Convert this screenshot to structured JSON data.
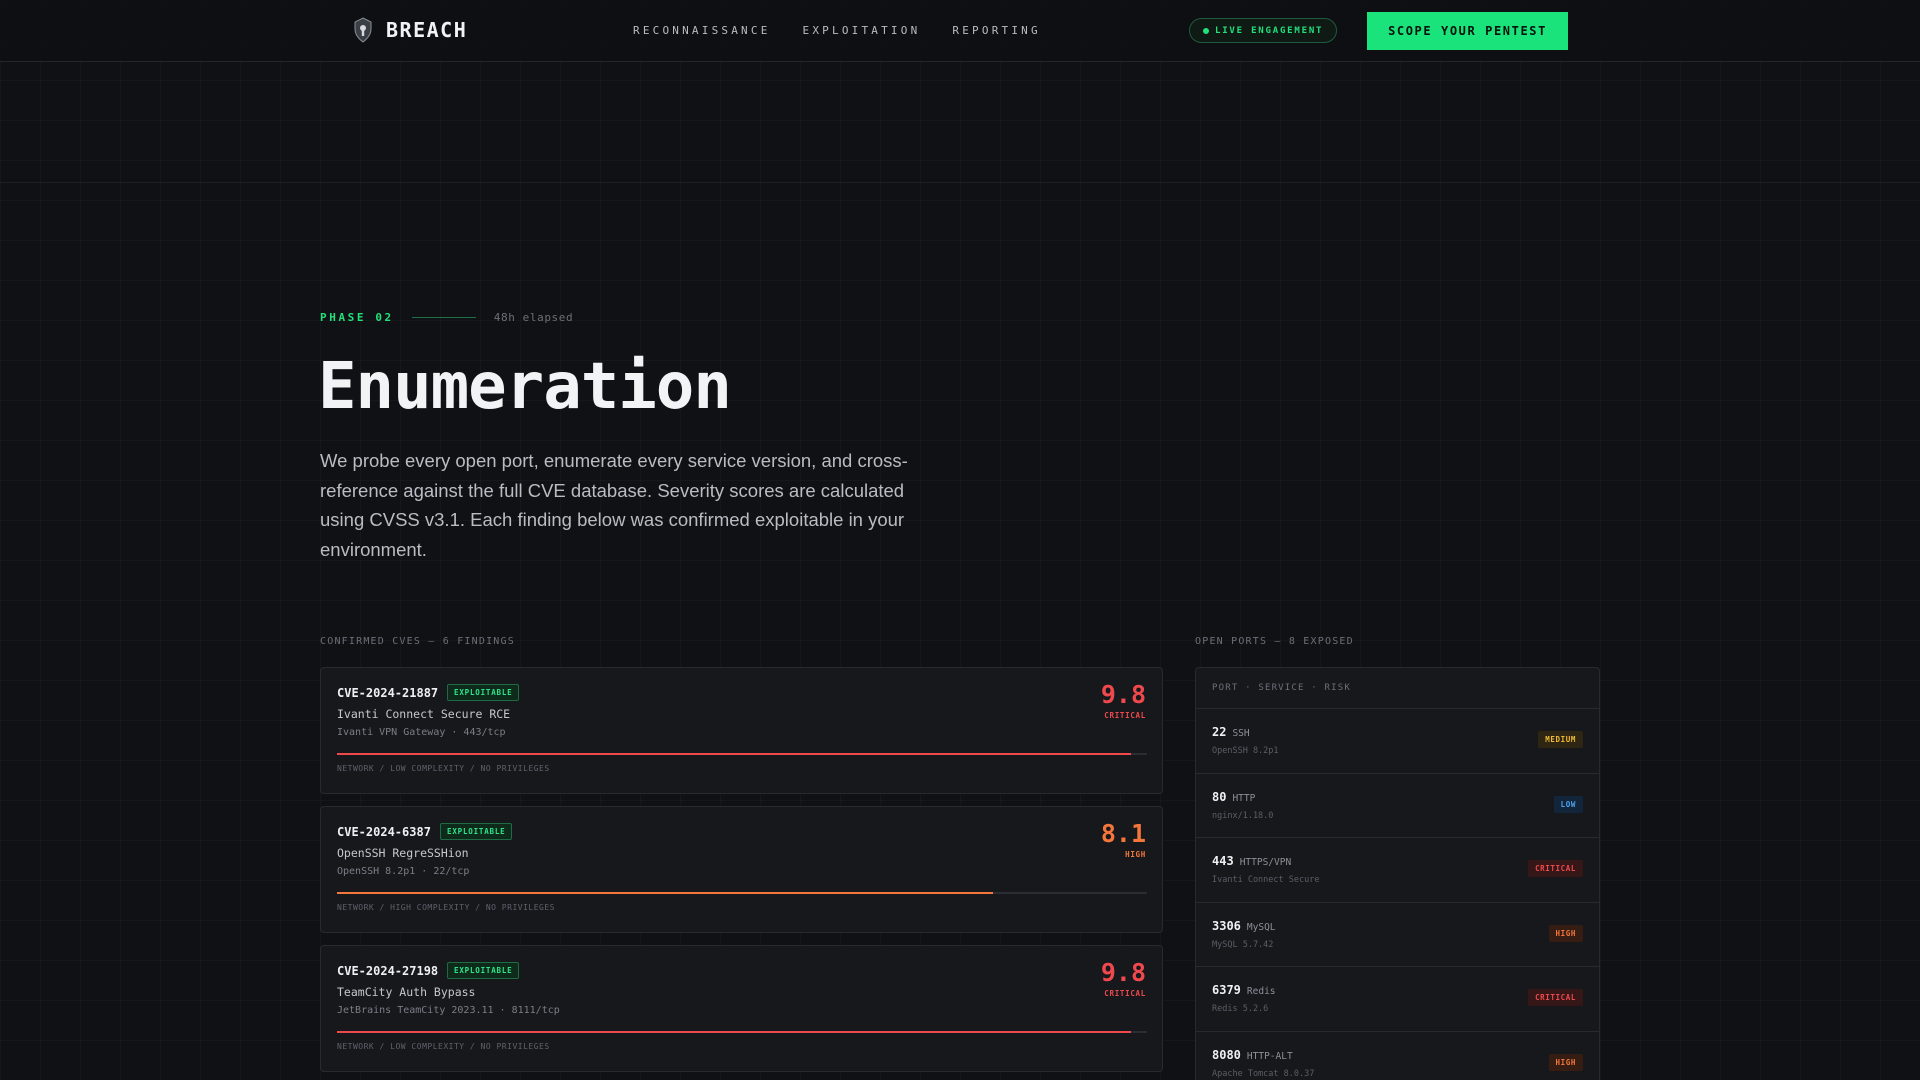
{
  "header": {
    "brand": "BREACH",
    "nav": [
      "RECONNAISSANCE",
      "EXPLOITATION",
      "REPORTING"
    ],
    "live_label": "LIVE ENGAGEMENT",
    "cta_label": "SCOPE YOUR PENTEST"
  },
  "hero": {
    "phase": "PHASE 02",
    "elapsed": "48h elapsed",
    "title": "Enumeration",
    "description": "We probe every open port, enumerate every service version, and cross-reference against the full CVE database. Severity scores are calculated using CVSS v3.1. Each finding below was confirmed exploitable in your environment."
  },
  "cves": {
    "section_label": "CONFIRMED CVES — 6 FINDINGS",
    "items": [
      {
        "id": "CVE-2024-21887",
        "badge": "EXPLOITABLE",
        "name": "Ivanti Connect Secure RCE",
        "target": "Ivanti VPN Gateway · 443/tcp",
        "score": "9.8",
        "severity": "CRITICAL",
        "score_fraction": 0.98,
        "color": "#f0494d",
        "vector": "NETWORK / LOW COMPLEXITY / NO PRIVILEGES"
      },
      {
        "id": "CVE-2024-6387",
        "badge": "EXPLOITABLE",
        "name": "OpenSSH RegreSSHion",
        "target": "OpenSSH 8.2p1 · 22/tcp",
        "score": "8.1",
        "severity": "HIGH",
        "score_fraction": 0.81,
        "color": "#f4763a",
        "vector": "NETWORK / HIGH COMPLEXITY / NO PRIVILEGES"
      },
      {
        "id": "CVE-2024-27198",
        "badge": "EXPLOITABLE",
        "name": "TeamCity Auth Bypass",
        "target": "JetBrains TeamCity 2023.11 · 8111/tcp",
        "score": "9.8",
        "severity": "CRITICAL",
        "score_fraction": 0.98,
        "color": "#f0494d",
        "vector": "NETWORK / LOW COMPLEXITY / NO PRIVILEGES"
      }
    ]
  },
  "ports": {
    "section_label": "OPEN PORTS — 8 EXPOSED",
    "table_header": "PORT · SERVICE · RISK",
    "items": [
      {
        "port": "22",
        "service": "SSH",
        "version": "OpenSSH 8.2p1",
        "risk": "MEDIUM",
        "risk_class": "medium"
      },
      {
        "port": "80",
        "service": "HTTP",
        "version": "nginx/1.18.0",
        "risk": "LOW",
        "risk_class": "low"
      },
      {
        "port": "443",
        "service": "HTTPS/VPN",
        "version": "Ivanti Connect Secure",
        "risk": "CRITICAL",
        "risk_class": "critical"
      },
      {
        "port": "3306",
        "service": "MySQL",
        "version": "MySQL 5.7.42",
        "risk": "HIGH",
        "risk_class": "high"
      },
      {
        "port": "6379",
        "service": "Redis",
        "version": "Redis 5.2.6",
        "risk": "CRITICAL",
        "risk_class": "critical"
      },
      {
        "port": "8080",
        "service": "HTTP-ALT",
        "version": "Apache Tomcat 8.0.37",
        "risk": "HIGH",
        "risk_class": "high"
      }
    ]
  },
  "colors": {
    "accent": "#19e37a",
    "critical": "#f0494d",
    "high": "#f4763a",
    "medium": "#f1b934",
    "low": "#4aa3f0"
  }
}
